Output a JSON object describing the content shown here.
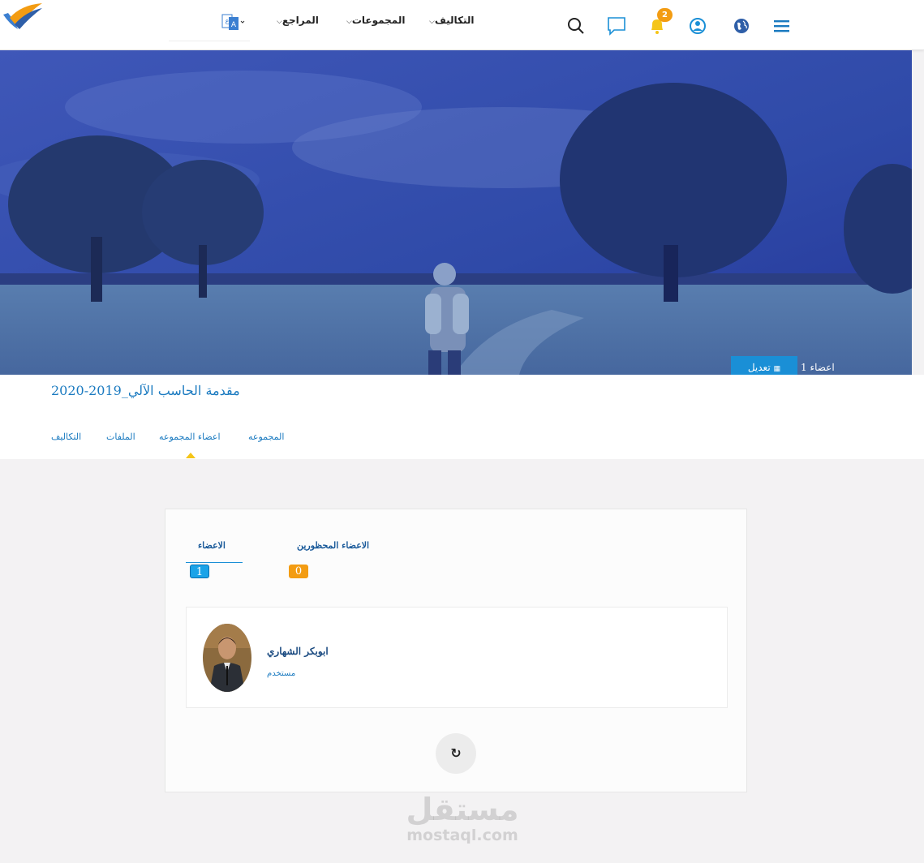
{
  "nav": {
    "items": [
      {
        "label": "التكاليف"
      },
      {
        "label": "المجموعات"
      },
      {
        "label": "المراجع"
      }
    ],
    "notifications_count": "2"
  },
  "group": {
    "title": "مقدمة الحاسب الآلي_2019-2020",
    "members_count": "اعضاء 1",
    "edit_label": "تعديل"
  },
  "tabs": [
    {
      "label": "المجموعه"
    },
    {
      "label": "اعضاء المجموعه"
    },
    {
      "label": "الملفات"
    },
    {
      "label": "التكاليف"
    }
  ],
  "members_panel": {
    "tabs": [
      {
        "label": "الاعضاء",
        "count": "1"
      },
      {
        "label": "الاعضاء المحظورين",
        "count": "0"
      }
    ],
    "members": [
      {
        "name": "ابوبكر الشهاري",
        "role": "مستخدم"
      }
    ],
    "refresh_icon": "↻"
  },
  "watermark": {
    "ar": "مستقل",
    "en": "mostaql.com"
  },
  "colors": {
    "accent": "#1a8fd6",
    "link": "#1a7ac0",
    "badge_orange": "#f39c12"
  }
}
